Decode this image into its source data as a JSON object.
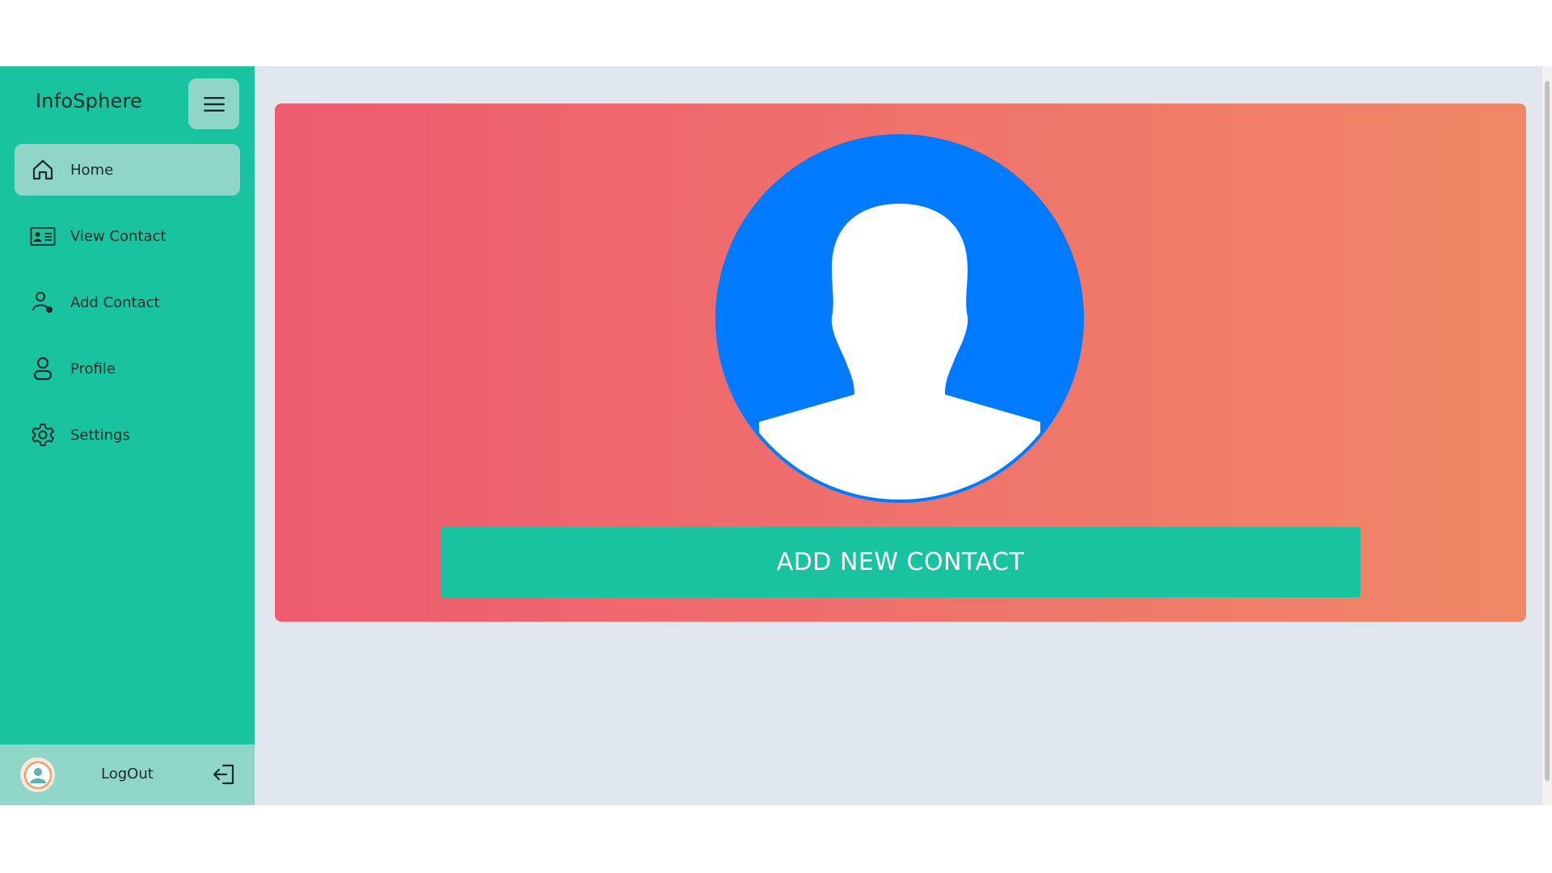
{
  "sidebar": {
    "brand": "InfoSphere",
    "menu_icon": "hamburger-icon",
    "items": [
      {
        "label": "Home",
        "icon": "home-icon",
        "active": true
      },
      {
        "label": "View Contact",
        "icon": "contact-card-icon",
        "active": false
      },
      {
        "label": "Add Contact",
        "icon": "add-user-icon",
        "active": false
      },
      {
        "label": "Profile",
        "icon": "user-icon",
        "active": false
      },
      {
        "label": "Settings",
        "icon": "gear-icon",
        "active": false
      }
    ],
    "logout": {
      "label": "LogOut",
      "icon": "logout-icon",
      "avatar_icon": "user-avatar-icon"
    }
  },
  "main": {
    "hero": {
      "avatar_icon": "person-silhouette-icon",
      "button_label": "ADD NEW CONTACT"
    }
  },
  "colors": {
    "sidebar_bg": "#19c39f",
    "sidebar_active": "#8fd6c8",
    "page_bg": "#e1e7ef",
    "hero_gradient_start": "#ee5b70",
    "hero_gradient_end": "#f08866",
    "avatar_blue": "#007bff",
    "button_bg": "#19c39f"
  }
}
